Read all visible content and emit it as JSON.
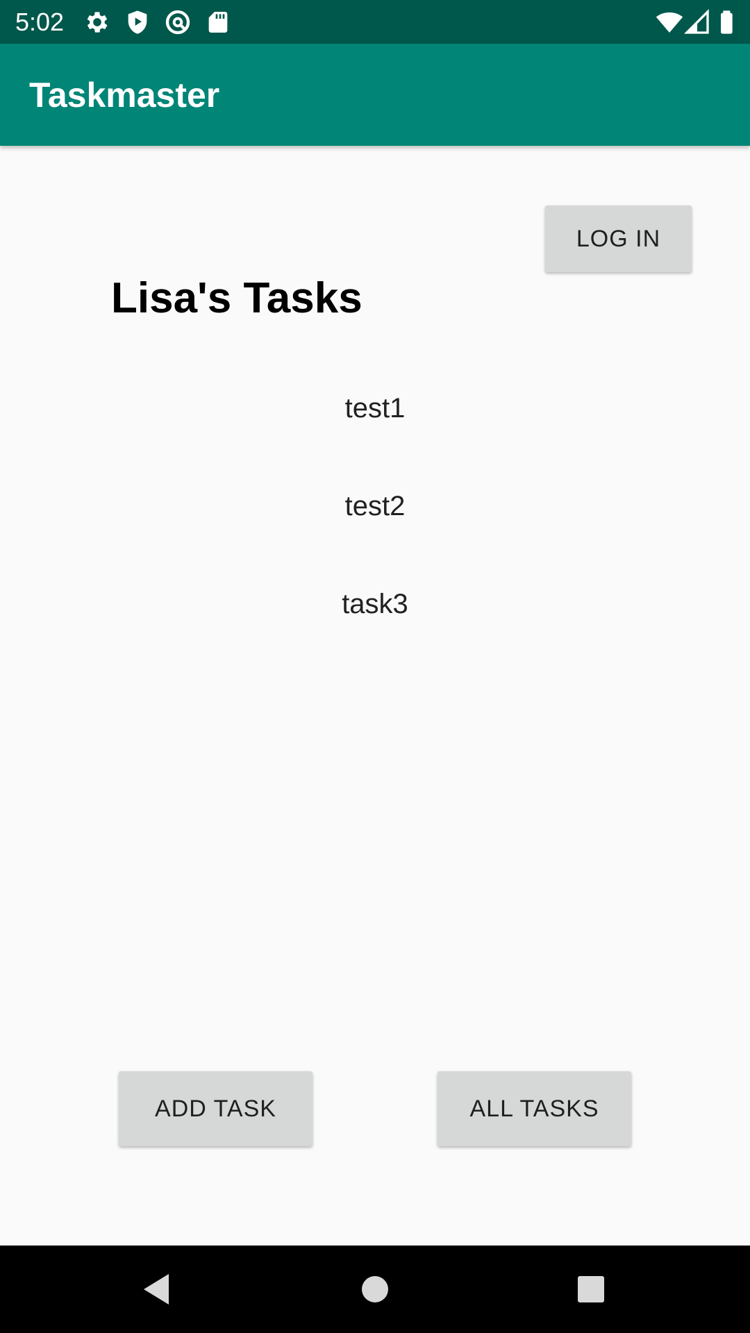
{
  "status_bar": {
    "time": "5:02",
    "icons_left": [
      "gear-icon",
      "shield-play-icon",
      "at-sync-icon",
      "sd-card-icon"
    ],
    "icons_right": [
      "wifi-icon",
      "cell-signal-icon",
      "battery-icon"
    ],
    "background": "#00574b"
  },
  "app_bar": {
    "title": "Taskmaster",
    "background": "#008577"
  },
  "header": {
    "login_label": "LOG IN",
    "title": "Lisa's Tasks"
  },
  "tasks": [
    {
      "label": "test1"
    },
    {
      "label": "test2"
    },
    {
      "label": "task3"
    }
  ],
  "footer": {
    "add_task_label": "ADD TASK",
    "all_tasks_label": "ALL TASKS"
  },
  "nav_bar": {
    "buttons": [
      "back-icon",
      "home-icon",
      "recents-icon"
    ]
  }
}
